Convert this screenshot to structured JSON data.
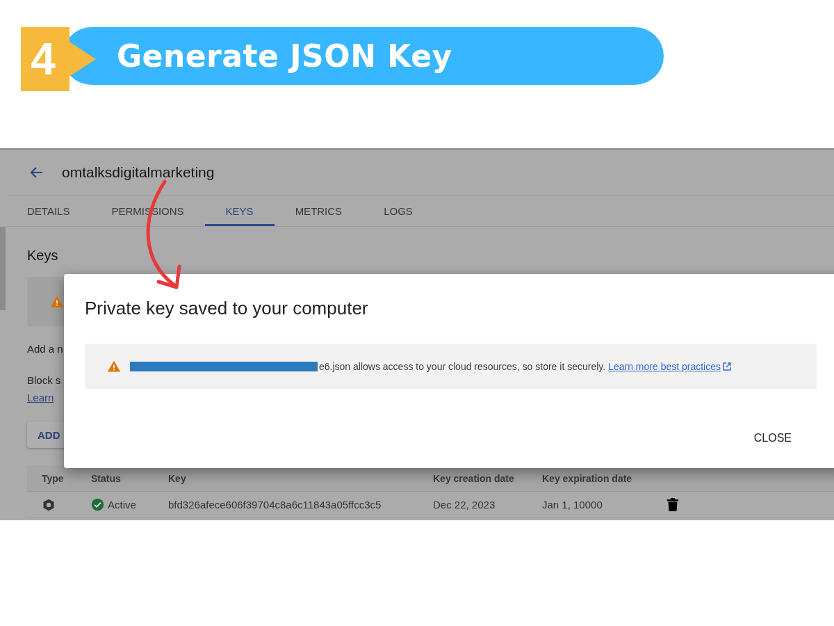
{
  "slide": {
    "step": "4",
    "title": "Generate JSON Key"
  },
  "console": {
    "title": "omtalksdigitalmarketing",
    "tabs": [
      {
        "label": "DETAILS",
        "selected": false
      },
      {
        "label": "PERMISSIONS",
        "selected": false
      },
      {
        "label": "KEYS",
        "selected": true
      },
      {
        "label": "METRICS",
        "selected": false
      },
      {
        "label": "LOGS",
        "selected": false
      }
    ],
    "section_title": "Keys",
    "lines": [
      {
        "kind": "text",
        "text": "Add a n"
      },
      {
        "kind": "text",
        "text": "Block s"
      },
      {
        "kind": "link",
        "text": "Learn"
      }
    ],
    "add_button": "ADD",
    "table": {
      "columns": [
        "Type",
        "Status",
        "Key",
        "Key creation date",
        "Key expiration date"
      ],
      "rows": [
        {
          "status": "Active",
          "key": "bfd326afece606f39704c8a6c11843a05ffcc3c5",
          "created": "Dec 22, 2023",
          "expires": "Jan 1, 10000"
        }
      ]
    }
  },
  "dialog": {
    "title": "Private key saved to your computer",
    "notice": {
      "text": "e6.json allows access to your cloud resources, so store it securely.",
      "link": "Learn more best practices"
    },
    "buttons": [
      "CLOSE"
    ]
  }
}
